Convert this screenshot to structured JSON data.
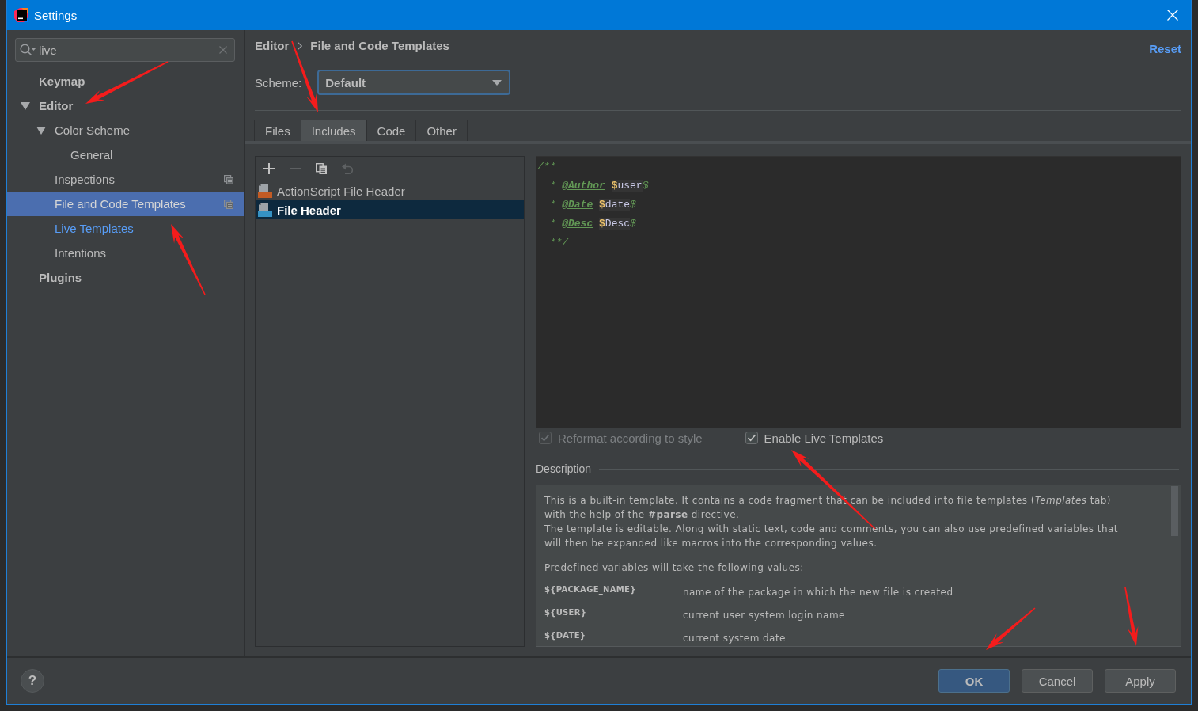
{
  "window": {
    "title": "Settings"
  },
  "search": {
    "value": "live"
  },
  "sidebar": {
    "items": [
      {
        "label": "Keymap",
        "selected": false,
        "highlighted": false,
        "project_scope": false
      },
      {
        "label": "Editor",
        "expanded": true,
        "selected": false,
        "highlighted": false,
        "project_scope": false,
        "children": [
          {
            "label": "Color Scheme",
            "expanded": true,
            "selected": false,
            "highlighted": false,
            "project_scope": false,
            "children": [
              {
                "label": "General",
                "selected": false,
                "highlighted": false,
                "project_scope": false
              }
            ]
          },
          {
            "label": "Inspections",
            "selected": false,
            "highlighted": false,
            "project_scope": true
          },
          {
            "label": "File and Code Templates",
            "selected": true,
            "highlighted": false,
            "project_scope": true
          },
          {
            "label": "Live Templates",
            "selected": false,
            "highlighted": true,
            "project_scope": false
          },
          {
            "label": "Intentions",
            "selected": false,
            "highlighted": false,
            "project_scope": false
          }
        ]
      },
      {
        "label": "Plugins",
        "selected": false,
        "highlighted": false,
        "project_scope": false
      }
    ]
  },
  "header": {
    "breadcrumb": [
      "Editor",
      "File and Code Templates"
    ],
    "reset": "Reset"
  },
  "scheme": {
    "label": "Scheme:",
    "value": "Default"
  },
  "tabs": [
    {
      "label": "Files",
      "selected": false
    },
    {
      "label": "Includes",
      "selected": true
    },
    {
      "label": "Code",
      "selected": false
    },
    {
      "label": "Other",
      "selected": false
    }
  ],
  "template_list": {
    "toolbar": [
      {
        "kind": "add",
        "disabled": false
      },
      {
        "kind": "remove",
        "disabled": true
      },
      {
        "kind": "copy",
        "disabled": false
      },
      {
        "kind": "reset",
        "disabled": true
      }
    ],
    "items": [
      {
        "label": "ActionScript File Header",
        "kind": "actionscript",
        "selected": false,
        "modified": false
      },
      {
        "label": "File Header",
        "kind": "java",
        "selected": true,
        "modified": true
      }
    ]
  },
  "editor": {
    "lines": [
      [
        {
          "kind": "comment",
          "text": "/**"
        }
      ],
      [
        {
          "kind": "comment",
          "text": "  * "
        },
        {
          "kind": "tag",
          "text": "@Author "
        },
        {
          "kind": "dollar",
          "text": "$"
        },
        {
          "kind": "variable",
          "text": "user"
        },
        {
          "kind": "comment",
          "text": "$"
        }
      ],
      [
        {
          "kind": "comment",
          "text": "  * "
        },
        {
          "kind": "tag",
          "text": "@Date "
        },
        {
          "kind": "dollar",
          "text": "$"
        },
        {
          "kind": "variable",
          "text": "date"
        },
        {
          "kind": "comment",
          "text": "$"
        }
      ],
      [
        {
          "kind": "comment",
          "text": "  * "
        },
        {
          "kind": "tag",
          "text": "@Desc "
        },
        {
          "kind": "dollar",
          "text": "$"
        },
        {
          "kind": "variable",
          "text": "Desc"
        },
        {
          "kind": "comment",
          "text": "$"
        }
      ],
      [
        {
          "kind": "comment",
          "text": "  **/"
        }
      ]
    ]
  },
  "options": [
    {
      "label": "Reformat according to style",
      "checked": true,
      "disabled": true
    },
    {
      "label": "Enable Live Templates",
      "checked": true,
      "disabled": false
    }
  ],
  "description": {
    "title": "Description",
    "paragraphs": [
      "This is a built-in template. It contains a code fragment that can be included into file templates (*Templates* tab) with the help of the **#parse** directive.",
      "The template is editable. Along with static text, code and comments, you can also use predefined variables that will then be expanded like macros into the corresponding values."
    ],
    "intro": "Predefined variables will take the following values:",
    "variables": [
      {
        "name": "${PACKAGE_NAME}",
        "meaning": "name of the package in which the new file is created"
      },
      {
        "name": "${USER}",
        "meaning": "current user system login name"
      },
      {
        "name": "${DATE}",
        "meaning": "current system date"
      }
    ]
  },
  "footer": {
    "help": "?",
    "buttons": [
      {
        "label": "OK",
        "kind": "default"
      },
      {
        "label": "Cancel",
        "kind": "normal"
      },
      {
        "label": "Apply",
        "kind": "normal"
      }
    ]
  }
}
